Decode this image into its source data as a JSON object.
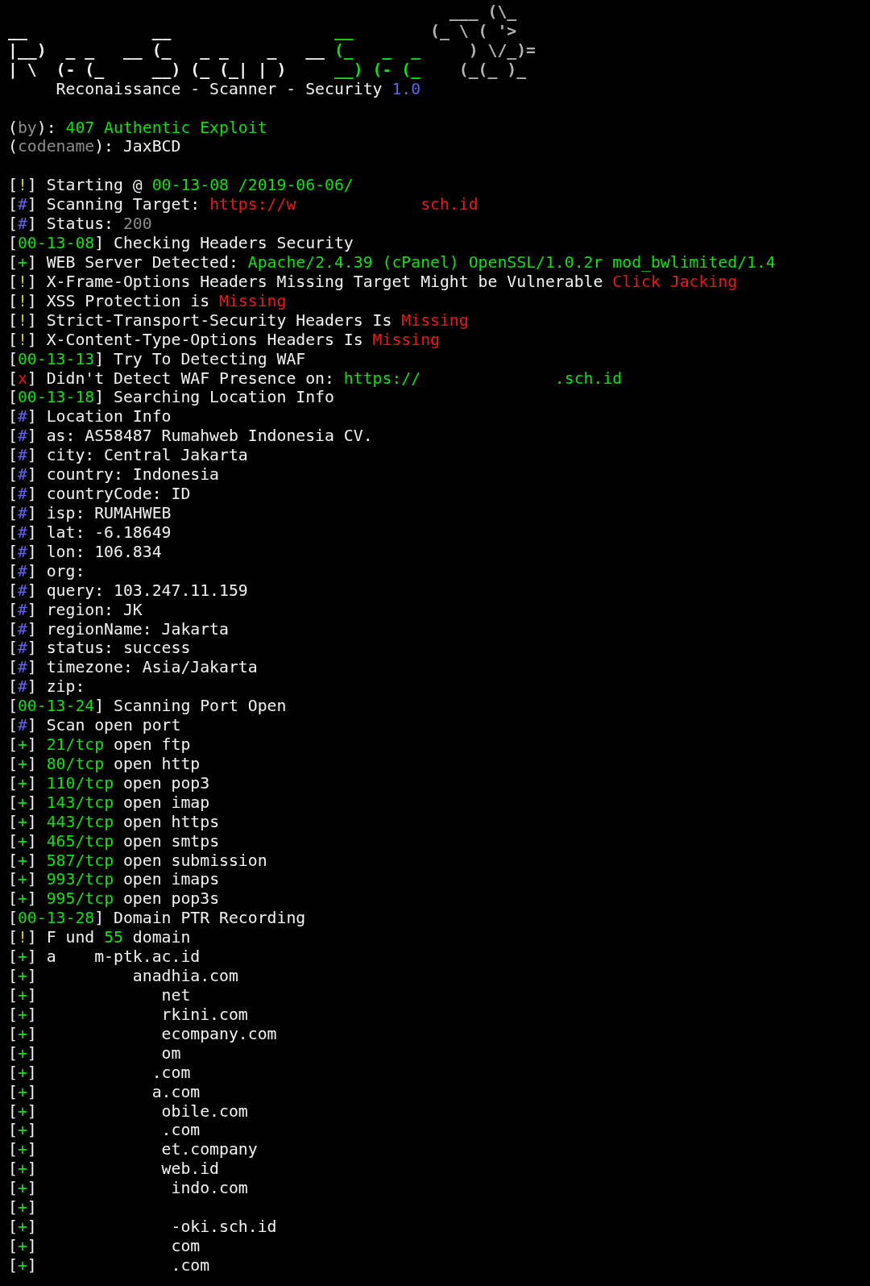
{
  "lines": [
    {
      "kind": "art",
      "segments": [
        {
          "text": "                                              ___ (\\_",
          "color": "#b4b4b4"
        }
      ]
    },
    {
      "kind": "art",
      "segments": [
        {
          "text": "__             __                ",
          "color": "#f2f2f2"
        },
        {
          "text": " __",
          "color": "#11e011"
        },
        {
          "text": "        (_ \\ ( '>",
          "color": "#b4b4b4"
        }
      ]
    },
    {
      "kind": "art",
      "segments": [
        {
          "text": "|__)  _ _   __ (_   _ _    _   __ ",
          "color": "#f2f2f2"
        },
        {
          "text": "(_   _  _",
          "color": "#11e011"
        },
        {
          "text": "     ) \\/_)=",
          "color": "#b4b4b4"
        }
      ]
    },
    {
      "kind": "art",
      "segments": [
        {
          "text": "| \\  (- (_     __) (_ (_| | )     ",
          "color": "#f2f2f2"
        },
        {
          "text": "__) (- (_",
          "color": "#11e011"
        },
        {
          "text": "    (_(_ )_",
          "color": "#b4b4b4"
        }
      ]
    },
    {
      "kind": "text",
      "segments": [
        {
          "text": "     Reconaissance - Scanner - Security ",
          "color": "#f2f2f2"
        },
        {
          "text": "1.0",
          "color": "#6464f0"
        }
      ]
    },
    {
      "kind": "blank"
    },
    {
      "kind": "text",
      "segments": [
        {
          "text": "(",
          "color": "#f2f2f2"
        },
        {
          "text": "by",
          "color": "#8c8c8c"
        },
        {
          "text": "): ",
          "color": "#f2f2f2"
        },
        {
          "text": "407 Authentic Exploit",
          "color": "#11e011"
        }
      ]
    },
    {
      "kind": "text",
      "segments": [
        {
          "text": "(",
          "color": "#f2f2f2"
        },
        {
          "text": "codename",
          "color": "#8c8c8c"
        },
        {
          "text": "): JaxBCD",
          "color": "#f2f2f2"
        }
      ]
    },
    {
      "kind": "blank"
    },
    {
      "kind": "text",
      "segments": [
        {
          "text": "[",
          "color": "#f2f2f2"
        },
        {
          "text": "!",
          "color": "#d0d000"
        },
        {
          "text": "] Starting @ ",
          "color": "#f2f2f2"
        },
        {
          "text": "00-13-08 /2019-06-06/",
          "color": "#11e011"
        }
      ]
    },
    {
      "kind": "text",
      "segments": [
        {
          "text": "[",
          "color": "#f2f2f2"
        },
        {
          "text": "#",
          "color": "#6464f0"
        },
        {
          "text": "] Scanning Target: ",
          "color": "#f2f2f2"
        },
        {
          "text": "https://w             sch.id",
          "color": "#e81a1a"
        }
      ]
    },
    {
      "kind": "text",
      "segments": [
        {
          "text": "[",
          "color": "#f2f2f2"
        },
        {
          "text": "#",
          "color": "#6464f0"
        },
        {
          "text": "] Status: ",
          "color": "#f2f2f2"
        },
        {
          "text": "200",
          "color": "#8c8c8c"
        }
      ]
    },
    {
      "kind": "text",
      "segments": [
        {
          "text": "[",
          "color": "#f2f2f2"
        },
        {
          "text": "00-13-08",
          "color": "#11e011"
        },
        {
          "text": "] Checking Headers Security",
          "color": "#f2f2f2"
        }
      ]
    },
    {
      "kind": "text",
      "segments": [
        {
          "text": "[",
          "color": "#f2f2f2"
        },
        {
          "text": "+",
          "color": "#11e011"
        },
        {
          "text": "] WEB Server Detected: ",
          "color": "#f2f2f2"
        },
        {
          "text": "Apache/2.4.39 (cPanel) OpenSSL/1.0.2r mod_bwlimited/1.4",
          "color": "#11e011"
        }
      ]
    },
    {
      "kind": "text",
      "segments": [
        {
          "text": "[",
          "color": "#f2f2f2"
        },
        {
          "text": "!",
          "color": "#d0d000"
        },
        {
          "text": "] X-Frame-Options Headers Missing Target Might be Vulnerable ",
          "color": "#f2f2f2"
        },
        {
          "text": "Click Jacking",
          "color": "#e81a1a"
        }
      ]
    },
    {
      "kind": "text",
      "segments": [
        {
          "text": "[",
          "color": "#f2f2f2"
        },
        {
          "text": "!",
          "color": "#d0d000"
        },
        {
          "text": "] XSS Protection is ",
          "color": "#f2f2f2"
        },
        {
          "text": "Missing",
          "color": "#e81a1a"
        }
      ]
    },
    {
      "kind": "text",
      "segments": [
        {
          "text": "[",
          "color": "#f2f2f2"
        },
        {
          "text": "!",
          "color": "#d0d000"
        },
        {
          "text": "] Strict-Transport-Security Headers Is ",
          "color": "#f2f2f2"
        },
        {
          "text": "Missing",
          "color": "#e81a1a"
        }
      ]
    },
    {
      "kind": "text",
      "segments": [
        {
          "text": "[",
          "color": "#f2f2f2"
        },
        {
          "text": "!",
          "color": "#d0d000"
        },
        {
          "text": "] X-Content-Type-Options Headers Is ",
          "color": "#f2f2f2"
        },
        {
          "text": "Missing",
          "color": "#e81a1a"
        }
      ]
    },
    {
      "kind": "text",
      "segments": [
        {
          "text": "[",
          "color": "#f2f2f2"
        },
        {
          "text": "00-13-13",
          "color": "#11e011"
        },
        {
          "text": "] Try To Detecting WAF",
          "color": "#f2f2f2"
        }
      ]
    },
    {
      "kind": "text",
      "segments": [
        {
          "text": "[",
          "color": "#f2f2f2"
        },
        {
          "text": "x",
          "color": "#e81a1a"
        },
        {
          "text": "] Didn't Detect WAF Presence on: ",
          "color": "#f2f2f2"
        },
        {
          "text": "https://              .sch.id",
          "color": "#11e011"
        }
      ]
    },
    {
      "kind": "text",
      "segments": [
        {
          "text": "[",
          "color": "#f2f2f2"
        },
        {
          "text": "00-13-18",
          "color": "#11e011"
        },
        {
          "text": "] Searching Location Info",
          "color": "#f2f2f2"
        }
      ]
    },
    {
      "kind": "text",
      "segments": [
        {
          "text": "[",
          "color": "#f2f2f2"
        },
        {
          "text": "#",
          "color": "#6464f0"
        },
        {
          "text": "] Location Info",
          "color": "#f2f2f2"
        }
      ]
    },
    {
      "kind": "text",
      "segments": [
        {
          "text": "[",
          "color": "#f2f2f2"
        },
        {
          "text": "#",
          "color": "#6464f0"
        },
        {
          "text": "] as: AS58487 Rumahweb Indonesia CV.",
          "color": "#f2f2f2"
        }
      ]
    },
    {
      "kind": "text",
      "segments": [
        {
          "text": "[",
          "color": "#f2f2f2"
        },
        {
          "text": "#",
          "color": "#6464f0"
        },
        {
          "text": "] city: Central Jakarta",
          "color": "#f2f2f2"
        }
      ]
    },
    {
      "kind": "text",
      "segments": [
        {
          "text": "[",
          "color": "#f2f2f2"
        },
        {
          "text": "#",
          "color": "#6464f0"
        },
        {
          "text": "] country: Indonesia",
          "color": "#f2f2f2"
        }
      ]
    },
    {
      "kind": "text",
      "segments": [
        {
          "text": "[",
          "color": "#f2f2f2"
        },
        {
          "text": "#",
          "color": "#6464f0"
        },
        {
          "text": "] countryCode: ID",
          "color": "#f2f2f2"
        }
      ]
    },
    {
      "kind": "text",
      "segments": [
        {
          "text": "[",
          "color": "#f2f2f2"
        },
        {
          "text": "#",
          "color": "#6464f0"
        },
        {
          "text": "] isp: RUMAHWEB",
          "color": "#f2f2f2"
        }
      ]
    },
    {
      "kind": "text",
      "segments": [
        {
          "text": "[",
          "color": "#f2f2f2"
        },
        {
          "text": "#",
          "color": "#6464f0"
        },
        {
          "text": "] lat: -6.18649",
          "color": "#f2f2f2"
        }
      ]
    },
    {
      "kind": "text",
      "segments": [
        {
          "text": "[",
          "color": "#f2f2f2"
        },
        {
          "text": "#",
          "color": "#6464f0"
        },
        {
          "text": "] lon: 106.834",
          "color": "#f2f2f2"
        }
      ]
    },
    {
      "kind": "text",
      "segments": [
        {
          "text": "[",
          "color": "#f2f2f2"
        },
        {
          "text": "#",
          "color": "#6464f0"
        },
        {
          "text": "] org:",
          "color": "#f2f2f2"
        }
      ]
    },
    {
      "kind": "text",
      "segments": [
        {
          "text": "[",
          "color": "#f2f2f2"
        },
        {
          "text": "#",
          "color": "#6464f0"
        },
        {
          "text": "] query: 103.247.11.159",
          "color": "#f2f2f2"
        }
      ]
    },
    {
      "kind": "text",
      "segments": [
        {
          "text": "[",
          "color": "#f2f2f2"
        },
        {
          "text": "#",
          "color": "#6464f0"
        },
        {
          "text": "] region: JK",
          "color": "#f2f2f2"
        }
      ]
    },
    {
      "kind": "text",
      "segments": [
        {
          "text": "[",
          "color": "#f2f2f2"
        },
        {
          "text": "#",
          "color": "#6464f0"
        },
        {
          "text": "] regionName: Jakarta",
          "color": "#f2f2f2"
        }
      ]
    },
    {
      "kind": "text",
      "segments": [
        {
          "text": "[",
          "color": "#f2f2f2"
        },
        {
          "text": "#",
          "color": "#6464f0"
        },
        {
          "text": "] status: success",
          "color": "#f2f2f2"
        }
      ]
    },
    {
      "kind": "text",
      "segments": [
        {
          "text": "[",
          "color": "#f2f2f2"
        },
        {
          "text": "#",
          "color": "#6464f0"
        },
        {
          "text": "] timezone: Asia/Jakarta",
          "color": "#f2f2f2"
        }
      ]
    },
    {
      "kind": "text",
      "segments": [
        {
          "text": "[",
          "color": "#f2f2f2"
        },
        {
          "text": "#",
          "color": "#6464f0"
        },
        {
          "text": "] zip:",
          "color": "#f2f2f2"
        }
      ]
    },
    {
      "kind": "text",
      "segments": [
        {
          "text": "[",
          "color": "#f2f2f2"
        },
        {
          "text": "00-13-24",
          "color": "#11e011"
        },
        {
          "text": "] Scanning Port Open",
          "color": "#f2f2f2"
        }
      ]
    },
    {
      "kind": "text",
      "segments": [
        {
          "text": "[",
          "color": "#f2f2f2"
        },
        {
          "text": "#",
          "color": "#6464f0"
        },
        {
          "text": "] Scan open port",
          "color": "#f2f2f2"
        }
      ]
    },
    {
      "kind": "text",
      "segments": [
        {
          "text": "[",
          "color": "#f2f2f2"
        },
        {
          "text": "+",
          "color": "#11e011"
        },
        {
          "text": "] ",
          "color": "#f2f2f2"
        },
        {
          "text": "21/tcp",
          "color": "#11e011"
        },
        {
          "text": " open ftp",
          "color": "#f2f2f2"
        }
      ]
    },
    {
      "kind": "text",
      "segments": [
        {
          "text": "[",
          "color": "#f2f2f2"
        },
        {
          "text": "+",
          "color": "#11e011"
        },
        {
          "text": "] ",
          "color": "#f2f2f2"
        },
        {
          "text": "80/tcp",
          "color": "#11e011"
        },
        {
          "text": " open http",
          "color": "#f2f2f2"
        }
      ]
    },
    {
      "kind": "text",
      "segments": [
        {
          "text": "[",
          "color": "#f2f2f2"
        },
        {
          "text": "+",
          "color": "#11e011"
        },
        {
          "text": "] ",
          "color": "#f2f2f2"
        },
        {
          "text": "110/tcp",
          "color": "#11e011"
        },
        {
          "text": " open pop3",
          "color": "#f2f2f2"
        }
      ]
    },
    {
      "kind": "text",
      "segments": [
        {
          "text": "[",
          "color": "#f2f2f2"
        },
        {
          "text": "+",
          "color": "#11e011"
        },
        {
          "text": "] ",
          "color": "#f2f2f2"
        },
        {
          "text": "143/tcp",
          "color": "#11e011"
        },
        {
          "text": " open imap",
          "color": "#f2f2f2"
        }
      ]
    },
    {
      "kind": "text",
      "segments": [
        {
          "text": "[",
          "color": "#f2f2f2"
        },
        {
          "text": "+",
          "color": "#11e011"
        },
        {
          "text": "] ",
          "color": "#f2f2f2"
        },
        {
          "text": "443/tcp",
          "color": "#11e011"
        },
        {
          "text": " open https",
          "color": "#f2f2f2"
        }
      ]
    },
    {
      "kind": "text",
      "segments": [
        {
          "text": "[",
          "color": "#f2f2f2"
        },
        {
          "text": "+",
          "color": "#11e011"
        },
        {
          "text": "] ",
          "color": "#f2f2f2"
        },
        {
          "text": "465/tcp",
          "color": "#11e011"
        },
        {
          "text": " open smtps",
          "color": "#f2f2f2"
        }
      ]
    },
    {
      "kind": "text",
      "segments": [
        {
          "text": "[",
          "color": "#f2f2f2"
        },
        {
          "text": "+",
          "color": "#11e011"
        },
        {
          "text": "] ",
          "color": "#f2f2f2"
        },
        {
          "text": "587/tcp",
          "color": "#11e011"
        },
        {
          "text": " open submission",
          "color": "#f2f2f2"
        }
      ]
    },
    {
      "kind": "text",
      "segments": [
        {
          "text": "[",
          "color": "#f2f2f2"
        },
        {
          "text": "+",
          "color": "#11e011"
        },
        {
          "text": "] ",
          "color": "#f2f2f2"
        },
        {
          "text": "993/tcp",
          "color": "#11e011"
        },
        {
          "text": " open imaps",
          "color": "#f2f2f2"
        }
      ]
    },
    {
      "kind": "text",
      "segments": [
        {
          "text": "[",
          "color": "#f2f2f2"
        },
        {
          "text": "+",
          "color": "#11e011"
        },
        {
          "text": "] ",
          "color": "#f2f2f2"
        },
        {
          "text": "995/tcp",
          "color": "#11e011"
        },
        {
          "text": " open pop3s",
          "color": "#f2f2f2"
        }
      ]
    },
    {
      "kind": "text",
      "segments": [
        {
          "text": "[",
          "color": "#f2f2f2"
        },
        {
          "text": "00-13-28",
          "color": "#11e011"
        },
        {
          "text": "] Domain PTR Recording",
          "color": "#f2f2f2"
        }
      ]
    },
    {
      "kind": "text",
      "segments": [
        {
          "text": "[",
          "color": "#f2f2f2"
        },
        {
          "text": "!",
          "color": "#d0d000"
        },
        {
          "text": "] F und ",
          "color": "#f2f2f2"
        },
        {
          "text": "55",
          "color": "#11e011"
        },
        {
          "text": " domain",
          "color": "#f2f2f2"
        }
      ]
    },
    {
      "kind": "text",
      "segments": [
        {
          "text": "[",
          "color": "#f2f2f2"
        },
        {
          "text": "+",
          "color": "#11e011"
        },
        {
          "text": "] a    m-ptk.ac.id",
          "color": "#f2f2f2"
        }
      ]
    },
    {
      "kind": "text",
      "segments": [
        {
          "text": "[",
          "color": "#f2f2f2"
        },
        {
          "text": "+",
          "color": "#11e011"
        },
        {
          "text": "]          anadhia.com",
          "color": "#f2f2f2"
        }
      ]
    },
    {
      "kind": "text",
      "segments": [
        {
          "text": "[",
          "color": "#f2f2f2"
        },
        {
          "text": "+",
          "color": "#11e011"
        },
        {
          "text": "]             net",
          "color": "#f2f2f2"
        }
      ]
    },
    {
      "kind": "text",
      "segments": [
        {
          "text": "[",
          "color": "#f2f2f2"
        },
        {
          "text": "+",
          "color": "#11e011"
        },
        {
          "text": "]             rkini.com",
          "color": "#f2f2f2"
        }
      ]
    },
    {
      "kind": "text",
      "segments": [
        {
          "text": "[",
          "color": "#f2f2f2"
        },
        {
          "text": "+",
          "color": "#11e011"
        },
        {
          "text": "]             ecompany.com",
          "color": "#f2f2f2"
        }
      ]
    },
    {
      "kind": "text",
      "segments": [
        {
          "text": "[",
          "color": "#f2f2f2"
        },
        {
          "text": "+",
          "color": "#11e011"
        },
        {
          "text": "]             om",
          "color": "#f2f2f2"
        }
      ]
    },
    {
      "kind": "text",
      "segments": [
        {
          "text": "[",
          "color": "#f2f2f2"
        },
        {
          "text": "+",
          "color": "#11e011"
        },
        {
          "text": "]            .com",
          "color": "#f2f2f2"
        }
      ]
    },
    {
      "kind": "text",
      "segments": [
        {
          "text": "[",
          "color": "#f2f2f2"
        },
        {
          "text": "+",
          "color": "#11e011"
        },
        {
          "text": "]            a.com",
          "color": "#f2f2f2"
        }
      ]
    },
    {
      "kind": "text",
      "segments": [
        {
          "text": "[",
          "color": "#f2f2f2"
        },
        {
          "text": "+",
          "color": "#11e011"
        },
        {
          "text": "]             obile.com",
          "color": "#f2f2f2"
        }
      ]
    },
    {
      "kind": "text",
      "segments": [
        {
          "text": "[",
          "color": "#f2f2f2"
        },
        {
          "text": "+",
          "color": "#11e011"
        },
        {
          "text": "]             .com",
          "color": "#f2f2f2"
        }
      ]
    },
    {
      "kind": "text",
      "segments": [
        {
          "text": "[",
          "color": "#f2f2f2"
        },
        {
          "text": "+",
          "color": "#11e011"
        },
        {
          "text": "]             et.company",
          "color": "#f2f2f2"
        }
      ]
    },
    {
      "kind": "text",
      "segments": [
        {
          "text": "[",
          "color": "#f2f2f2"
        },
        {
          "text": "+",
          "color": "#11e011"
        },
        {
          "text": "]             web.id",
          "color": "#f2f2f2"
        }
      ]
    },
    {
      "kind": "text",
      "segments": [
        {
          "text": "[",
          "color": "#f2f2f2"
        },
        {
          "text": "+",
          "color": "#11e011"
        },
        {
          "text": "]              indo.com",
          "color": "#f2f2f2"
        }
      ]
    },
    {
      "kind": "text",
      "segments": [
        {
          "text": "[",
          "color": "#f2f2f2"
        },
        {
          "text": "+",
          "color": "#11e011"
        },
        {
          "text": "]",
          "color": "#f2f2f2"
        }
      ]
    },
    {
      "kind": "text",
      "segments": [
        {
          "text": "[",
          "color": "#f2f2f2"
        },
        {
          "text": "+",
          "color": "#11e011"
        },
        {
          "text": "]              -oki.sch.id",
          "color": "#f2f2f2"
        }
      ]
    },
    {
      "kind": "text",
      "segments": [
        {
          "text": "[",
          "color": "#f2f2f2"
        },
        {
          "text": "+",
          "color": "#11e011"
        },
        {
          "text": "]              com",
          "color": "#f2f2f2"
        }
      ]
    },
    {
      "kind": "text",
      "segments": [
        {
          "text": "[",
          "color": "#f2f2f2"
        },
        {
          "text": "+",
          "color": "#11e011"
        },
        {
          "text": "]              .com",
          "color": "#f2f2f2"
        }
      ]
    }
  ]
}
